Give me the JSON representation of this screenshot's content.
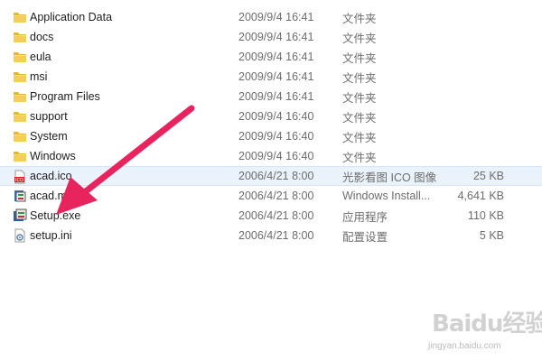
{
  "files": [
    {
      "name": "Application Data",
      "date": "2009/9/4 16:41",
      "type": "文件夹",
      "size": "",
      "icon": "folder-icon"
    },
    {
      "name": "docs",
      "date": "2009/9/4 16:41",
      "type": "文件夹",
      "size": "",
      "icon": "folder-icon"
    },
    {
      "name": "eula",
      "date": "2009/9/4 16:41",
      "type": "文件夹",
      "size": "",
      "icon": "folder-icon"
    },
    {
      "name": "msi",
      "date": "2009/9/4 16:41",
      "type": "文件夹",
      "size": "",
      "icon": "folder-icon"
    },
    {
      "name": "Program Files",
      "date": "2009/9/4 16:41",
      "type": "文件夹",
      "size": "",
      "icon": "folder-icon"
    },
    {
      "name": "support",
      "date": "2009/9/4 16:40",
      "type": "文件夹",
      "size": "",
      "icon": "folder-icon"
    },
    {
      "name": "System",
      "date": "2009/9/4 16:40",
      "type": "文件夹",
      "size": "",
      "icon": "folder-icon"
    },
    {
      "name": "Windows",
      "date": "2009/9/4 16:40",
      "type": "文件夹",
      "size": "",
      "icon": "folder-icon"
    },
    {
      "name": "acad.ico",
      "date": "2006/4/21 8:00",
      "type": "光影看图 ICO 图像",
      "size": "25 KB",
      "icon": "ico-file-icon"
    },
    {
      "name": "acad.msi",
      "date": "2006/4/21 8:00",
      "type": "Windows Install...",
      "size": "4,641 KB",
      "icon": "installer-icon"
    },
    {
      "name": "Setup.exe",
      "date": "2006/4/21 8:00",
      "type": "应用程序",
      "size": "110 KB",
      "icon": "setup-exe-icon"
    },
    {
      "name": "setup.ini",
      "date": "2006/4/21 8:00",
      "type": "配置设置",
      "size": "5 KB",
      "icon": "ini-file-icon"
    }
  ],
  "selected_index": 8,
  "watermark": {
    "logo": "Baidu经验",
    "url": "jingyan.baidu.com"
  },
  "colors": {
    "arrow": "#e8245e",
    "folder": "#e8c04a",
    "selection": "#eaf2fb"
  }
}
